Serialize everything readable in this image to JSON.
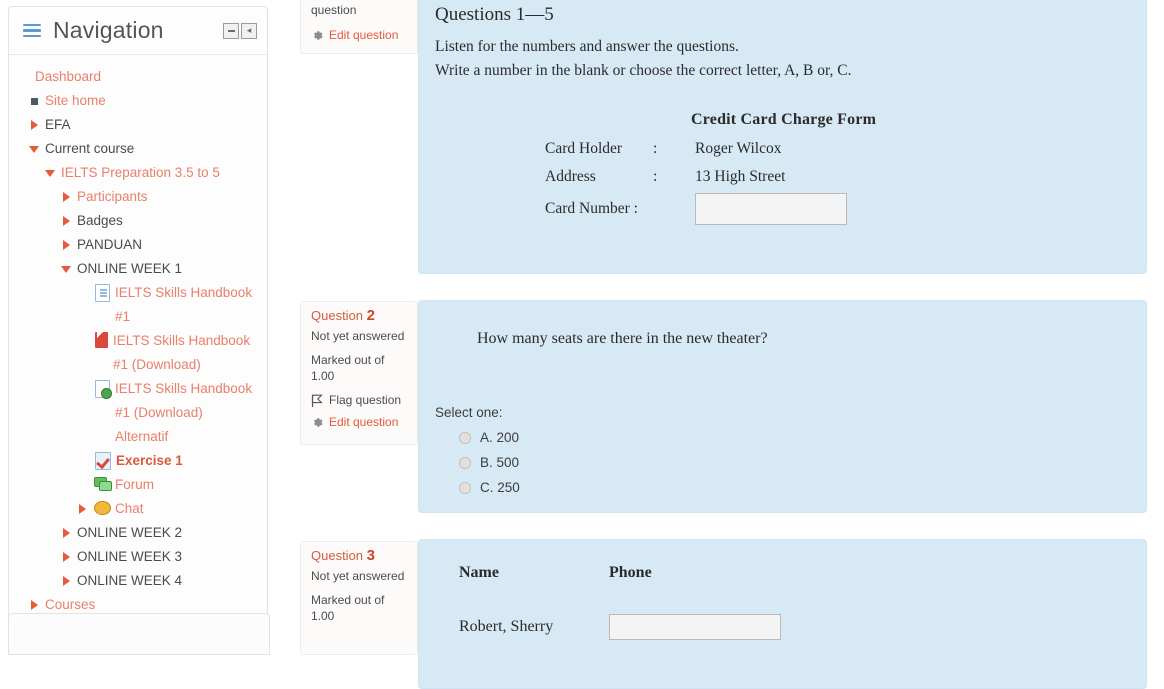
{
  "sidebar": {
    "block_title": "Navigation",
    "controls": {
      "minimize_label": "–",
      "dock_label": "◂"
    },
    "items": [
      {
        "label": "Dashboard",
        "level": 0,
        "twisty": "none",
        "icon": "none",
        "style": "link"
      },
      {
        "label": "Site home",
        "level": 1,
        "twisty": "square",
        "icon": "none",
        "style": "link"
      },
      {
        "label": "EFA",
        "level": 1,
        "twisty": "right",
        "icon": "none",
        "style": "plain"
      },
      {
        "label": "Current course",
        "level": 1,
        "twisty": "down",
        "icon": "none",
        "style": "plain"
      },
      {
        "label": "IELTS Preparation 3.5 to 5",
        "level": 2,
        "twisty": "down",
        "icon": "none",
        "style": "link"
      },
      {
        "label": "Participants",
        "level": 3,
        "twisty": "right",
        "icon": "none",
        "style": "link"
      },
      {
        "label": "Badges",
        "level": 3,
        "twisty": "right",
        "icon": "none",
        "style": "plain"
      },
      {
        "label": "PANDUAN",
        "level": 3,
        "twisty": "right",
        "icon": "none",
        "style": "plain"
      },
      {
        "label": "ONLINE WEEK 1",
        "level": 3,
        "twisty": "down",
        "icon": "none",
        "style": "plain"
      },
      {
        "label": "IELTS Skills Handbook #1",
        "level": 4,
        "twisty": "none",
        "icon": "doc",
        "style": "link"
      },
      {
        "label": "IELTS Skills Handbook #1 (Download)",
        "level": 4,
        "twisty": "none",
        "icon": "pdf",
        "style": "link"
      },
      {
        "label": "IELTS Skills Handbook #1 (Download) Alternatif",
        "level": 4,
        "twisty": "none",
        "icon": "url",
        "style": "link"
      },
      {
        "label": "Exercise 1",
        "level": 4,
        "twisty": "none",
        "icon": "quiz",
        "style": "bold"
      },
      {
        "label": "Forum",
        "level": 4,
        "twisty": "none",
        "icon": "forum",
        "style": "link"
      },
      {
        "label": "Chat",
        "level": 4,
        "twisty": "right",
        "icon": "chat",
        "style": "link"
      },
      {
        "label": "ONLINE WEEK 2",
        "level": 3,
        "twisty": "right",
        "icon": "none",
        "style": "plain"
      },
      {
        "label": "ONLINE WEEK 3",
        "level": 3,
        "twisty": "right",
        "icon": "none",
        "style": "plain"
      },
      {
        "label": "ONLINE WEEK 4",
        "level": 3,
        "twisty": "right",
        "icon": "none",
        "style": "plain"
      },
      {
        "label": "Courses",
        "level": 1,
        "twisty": "right",
        "icon": "none",
        "style": "link"
      }
    ]
  },
  "question_panels": {
    "panel1": {
      "edit_label": "Edit question",
      "flag_label_tail": "question"
    },
    "panel2": {
      "number_prefix": "Question",
      "number": "2",
      "state": "Not yet answered",
      "marked": "Marked out of 1.00",
      "flag_label": "Flag question",
      "edit_label": "Edit question"
    },
    "panel3": {
      "number_prefix": "Question",
      "number": "3",
      "state": "Not yet answered",
      "marked": "Marked out of 1.00"
    }
  },
  "question1": {
    "heading": "Questions 1—5",
    "line1": "Listen for the numbers and answer the questions.",
    "line2": "Write a number in the blank or choose the correct letter, A, B or, C.",
    "form": {
      "title": "Credit Card Charge Form",
      "rows": [
        {
          "label": "Card Holder",
          "colon": ":",
          "value": "Roger Wilcox",
          "input": false
        },
        {
          "label": "Address",
          "colon": ":",
          "value": "13 High Street",
          "input": false
        },
        {
          "label": "Card Number :",
          "colon": "",
          "value": "",
          "input": true
        }
      ],
      "card_number_value": ""
    }
  },
  "question2": {
    "text": "How many seats are there in the new theater?",
    "select_label": "Select one:",
    "options": [
      {
        "label": "A. 200",
        "selected": false
      },
      {
        "label": "B. 500",
        "selected": false
      },
      {
        "label": "C. 250",
        "selected": false
      }
    ]
  },
  "question3": {
    "headers": [
      "Name",
      "Phone"
    ],
    "rows": [
      {
        "name": "Robert, Sherry",
        "phone_value": ""
      }
    ]
  },
  "colors": {
    "question_card_bg": "#d7e9f5",
    "panel_bg": "#fdfafa",
    "accent_link": "#e8806a",
    "accent_strong": "#d9593e",
    "twisty": "#e8593c",
    "hamburger": "#5b9bd5"
  }
}
